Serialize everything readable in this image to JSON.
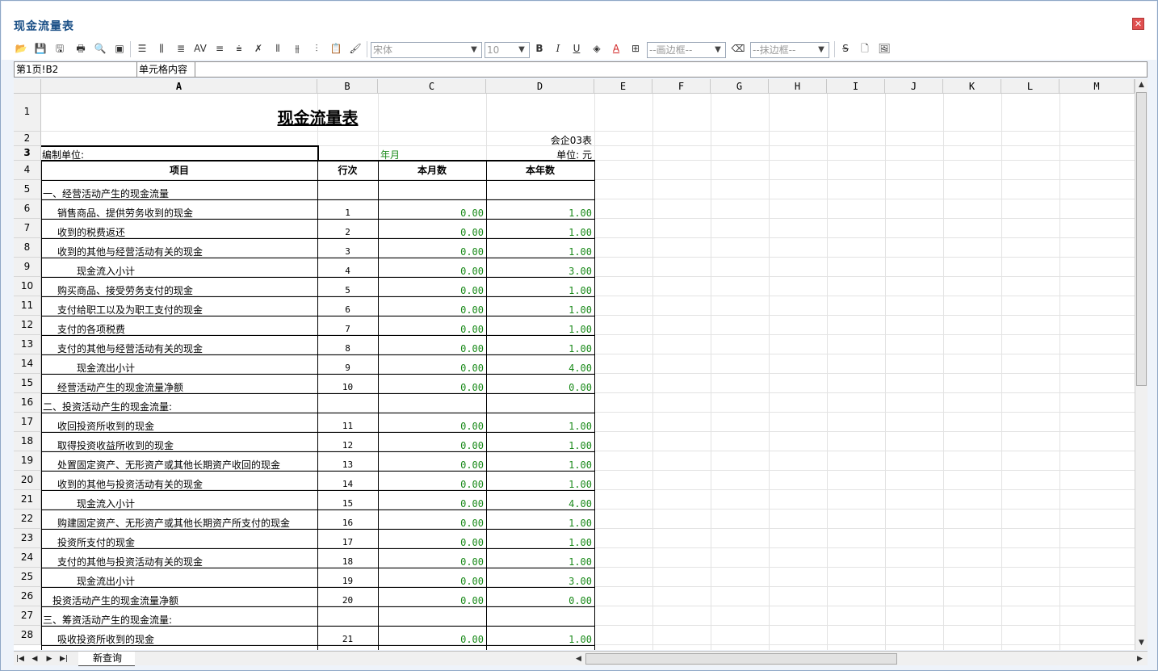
{
  "window": {
    "title": "现金流量表",
    "close_glyph": "✕"
  },
  "toolbar": {
    "font_name": "宋体",
    "font_size": "10",
    "border_select": "--画边框--",
    "erase_select": "--抹边框--",
    "bold_label": "B",
    "italic_label": "I",
    "underline_label": "U",
    "strike_label": "S"
  },
  "formula_bar": {
    "cell_ref": "第1页!B2",
    "content_label": "单元格内容"
  },
  "columns": [
    "A",
    "B",
    "C",
    "D",
    "E",
    "F",
    "G",
    "H",
    "I",
    "J",
    "K",
    "L",
    "M"
  ],
  "selected_column": "A",
  "selected_row": "3",
  "report": {
    "title": "现金流量表",
    "form_code": "会企03表",
    "org_label": "编制单位:",
    "period_label": "年月",
    "unit_label": "单位: 元",
    "headers": [
      "项目",
      "行次",
      "本月数",
      "本年数"
    ]
  },
  "rows": [
    {
      "n": "5",
      "item": "一、经营活动产生的现金流量",
      "line": "",
      "month": "",
      "year": "",
      "indent": 0
    },
    {
      "n": "6",
      "item": "销售商品、提供劳务收到的现金",
      "line": "1",
      "month": "0.00",
      "year": "1.00",
      "indent": 1
    },
    {
      "n": "7",
      "item": "收到的税费返还",
      "line": "2",
      "month": "0.00",
      "year": "1.00",
      "indent": 1
    },
    {
      "n": "8",
      "item": "收到的其他与经营活动有关的现金",
      "line": "3",
      "month": "0.00",
      "year": "1.00",
      "indent": 1
    },
    {
      "n": "9",
      "item": "现金流入小计",
      "line": "4",
      "month": "0.00",
      "year": "3.00",
      "indent": 2
    },
    {
      "n": "10",
      "item": "购买商品、接受劳务支付的现金",
      "line": "5",
      "month": "0.00",
      "year": "1.00",
      "indent": 1
    },
    {
      "n": "11",
      "item": "支付给职工以及为职工支付的现金",
      "line": "6",
      "month": "0.00",
      "year": "1.00",
      "indent": 1
    },
    {
      "n": "12",
      "item": "支付的各项税费",
      "line": "7",
      "month": "0.00",
      "year": "1.00",
      "indent": 1
    },
    {
      "n": "13",
      "item": "支付的其他与经营活动有关的现金",
      "line": "8",
      "month": "0.00",
      "year": "1.00",
      "indent": 1
    },
    {
      "n": "14",
      "item": "现金流出小计",
      "line": "9",
      "month": "0.00",
      "year": "4.00",
      "indent": 2
    },
    {
      "n": "15",
      "item": "经营活动产生的现金流量净额",
      "line": "10",
      "month": "0.00",
      "year": "0.00",
      "indent": 1
    },
    {
      "n": "16",
      "item": "二、投资活动产生的现金流量:",
      "line": "",
      "month": "",
      "year": "",
      "indent": 0
    },
    {
      "n": "17",
      "item": "收回投资所收到的现金",
      "line": "11",
      "month": "0.00",
      "year": "1.00",
      "indent": 1
    },
    {
      "n": "18",
      "item": "取得投资收益所收到的现金",
      "line": "12",
      "month": "0.00",
      "year": "1.00",
      "indent": 1
    },
    {
      "n": "19",
      "item": "处置固定资产、无形资产或其他长期资产收回的现金",
      "line": "13",
      "month": "0.00",
      "year": "1.00",
      "indent": 1
    },
    {
      "n": "20",
      "item": "收到的其他与投资活动有关的现金",
      "line": "14",
      "month": "0.00",
      "year": "1.00",
      "indent": 1
    },
    {
      "n": "21",
      "item": "现金流入小计",
      "line": "15",
      "month": "0.00",
      "year": "4.00",
      "indent": 2
    },
    {
      "n": "22",
      "item": "购建固定资产、无形资产或其他长期资产所支付的现金",
      "line": "16",
      "month": "0.00",
      "year": "1.00",
      "indent": 1
    },
    {
      "n": "23",
      "item": "投资所支付的现金",
      "line": "17",
      "month": "0.00",
      "year": "1.00",
      "indent": 1
    },
    {
      "n": "24",
      "item": "支付的其他与投资活动有关的现金",
      "line": "18",
      "month": "0.00",
      "year": "1.00",
      "indent": 1
    },
    {
      "n": "25",
      "item": "现金流出小计",
      "line": "19",
      "month": "0.00",
      "year": "3.00",
      "indent": 2
    },
    {
      "n": "26",
      "item": "投资活动产生的现金流量净额",
      "line": "20",
      "month": "0.00",
      "year": "0.00",
      "indent": 3
    },
    {
      "n": "27",
      "item": "三、筹资活动产生的现金流量:",
      "line": "",
      "month": "",
      "year": "",
      "indent": 0
    },
    {
      "n": "28",
      "item": "吸收投资所收到的现金",
      "line": "21",
      "month": "0.00",
      "year": "1.00",
      "indent": 1
    }
  ],
  "sheet_tab": "新查询"
}
